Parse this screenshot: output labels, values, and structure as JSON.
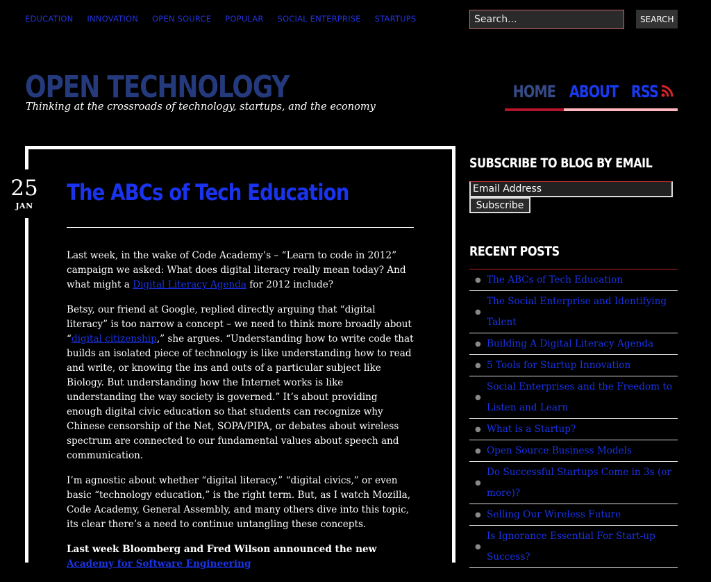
{
  "top_nav": [
    "EDUCATION",
    "INNOVATION",
    "OPEN SOURCE",
    "POPULAR",
    "SOCIAL ENTERPRISE",
    "STARTUPS"
  ],
  "search": {
    "placeholder": "Search...",
    "button": "SEARCH"
  },
  "site": {
    "title": "OPEN TECHNOLOGY",
    "tagline": "Thinking at the crossroads of technology, startups, and the economy"
  },
  "main_nav": {
    "home": "HOME",
    "about": "ABOUT",
    "rss": "RSS"
  },
  "colors": {
    "accent_blue": "#1a33e6",
    "nav_red": "#b3122b",
    "nav_pink": "#ffb6bf"
  },
  "post": {
    "date_day": "25",
    "date_month": "JAN",
    "title": "The ABCs of Tech Education",
    "p1_a": "Last week, in the wake of Code Academy’s  – “Learn to code in 2012” campaign we asked:  What does digital literacy really mean today?  And what might a ",
    "p1_link": "Digital Literacy Agenda",
    "p1_b": " for 2012 include?",
    "p2_a": "Betsy, our friend at Google, replied directly arguing that “digital literacy” is too narrow a concept – we need to think more broadly about “",
    "p2_link": "digital citizenship",
    "p2_b": ",” she argues. “Understanding how to write code that builds an isolated piece of technology is like understanding how to read and write, or knowing the ins and outs of a particular subject like Biology. But understanding how the Internet works is like understanding the way society is governed.”  It’s about providing enough digital civic education so that students can recognize why Chinese censorship of the Net, SOPA/PIPA, or debates about wireless spectrum are connected to our fundamental values about speech and communication.",
    "p3": "I’m agnostic about whether “digital literacy,” “digital civics,” or even basic “technology education,” is the right term. But, as I watch Mozilla, Code Academy, General Assembly, and many others dive into this topic, its clear there’s a need to continue untangling these concepts.",
    "p4_a": "Last week Bloomberg and Fred Wilson announced the new ",
    "p4_link": "Academy for Software Engineering"
  },
  "sidebar": {
    "subscribe_title": "SUBSCRIBE TO BLOG BY EMAIL",
    "email_placeholder": "Email Address",
    "subscribe_button": "Subscribe",
    "recent_title": "RECENT POSTS",
    "recent_posts": [
      "The ABCs of Tech Education",
      "The Social Enterprise and Identifying Talent",
      "Building A Digital Literacy Agenda",
      "5 Tools for Startup Innovation",
      "Social Enterprises and the Freedom to Listen and Learn",
      "What is a Startup?",
      "Open Source Business Models",
      "Do Successful Startups Come in 3s (or more)?",
      "Selling Our Wireless Future",
      "Is Ignorance Essential For Start-up Success?"
    ]
  }
}
